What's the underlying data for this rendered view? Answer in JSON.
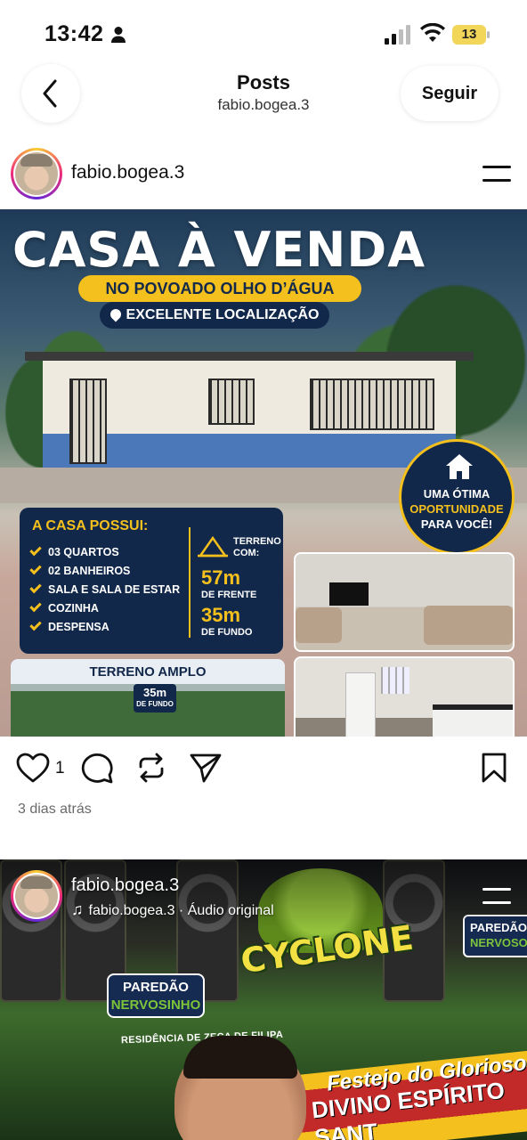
{
  "status_bar": {
    "time": "13:42",
    "battery": "13"
  },
  "header": {
    "title": "Posts",
    "subtitle": "fabio.bogea.3",
    "follow_label": "Seguir"
  },
  "post1": {
    "username": "fabio.bogea.3",
    "flyer": {
      "headline": "CASA À VENDA",
      "location_line": "NO POVOADO OLHO D’ÁGUA",
      "location_tag": "EXCELENTE LOCALIZAÇÃO",
      "badge": [
        "UMA ÓTIMA",
        "OPORTUNIDADE",
        "PARA VOCÊ!"
      ],
      "features_title": "A CASA POSSUI:",
      "features": [
        "03 QUARTOS",
        "02 BANHEIROS",
        "SALA E SALA DE ESTAR",
        "COZINHA",
        "DESPENSA"
      ],
      "terreno_label": [
        "TERRENO",
        "COM:"
      ],
      "frente_value": "57m",
      "frente_label": "DE FRENTE",
      "fundo_value": "35m",
      "fundo_label": "DE FUNDO",
      "terreno_card_title": "TERRENO AMPLO",
      "terreno_card_value": "35m",
      "terreno_card_label": "DE FUNDO"
    },
    "like_count": "1",
    "date": "3 dias atrás"
  },
  "post2": {
    "username": "fabio.bogea.3",
    "audio": "fabio.bogea.3 · Áudio original",
    "video_texts": {
      "brand": "CYCLONE",
      "paredao_left": [
        "PAREDÃO",
        "NERVOSINHO"
      ],
      "paredao_right": [
        "PAREDÃO",
        "NERVOSO"
      ],
      "residencia": "RESIDÊNCIA DE ZECA DE FILIPA",
      "banner_line1": "Festejo do Glorioso",
      "banner_line2": "DIVINO ESPÍRITO SANT"
    }
  },
  "colors": {
    "navy": "#12284a",
    "yellow": "#f4c01e",
    "blue_stripe": "#4a78b9"
  },
  "icons": [
    "person-icon",
    "signal-icon",
    "wifi-icon",
    "battery-icon",
    "back-icon",
    "menu-icon",
    "heart-icon",
    "comment-icon",
    "repost-icon",
    "share-icon",
    "bookmark-icon",
    "music-note-icon"
  ]
}
